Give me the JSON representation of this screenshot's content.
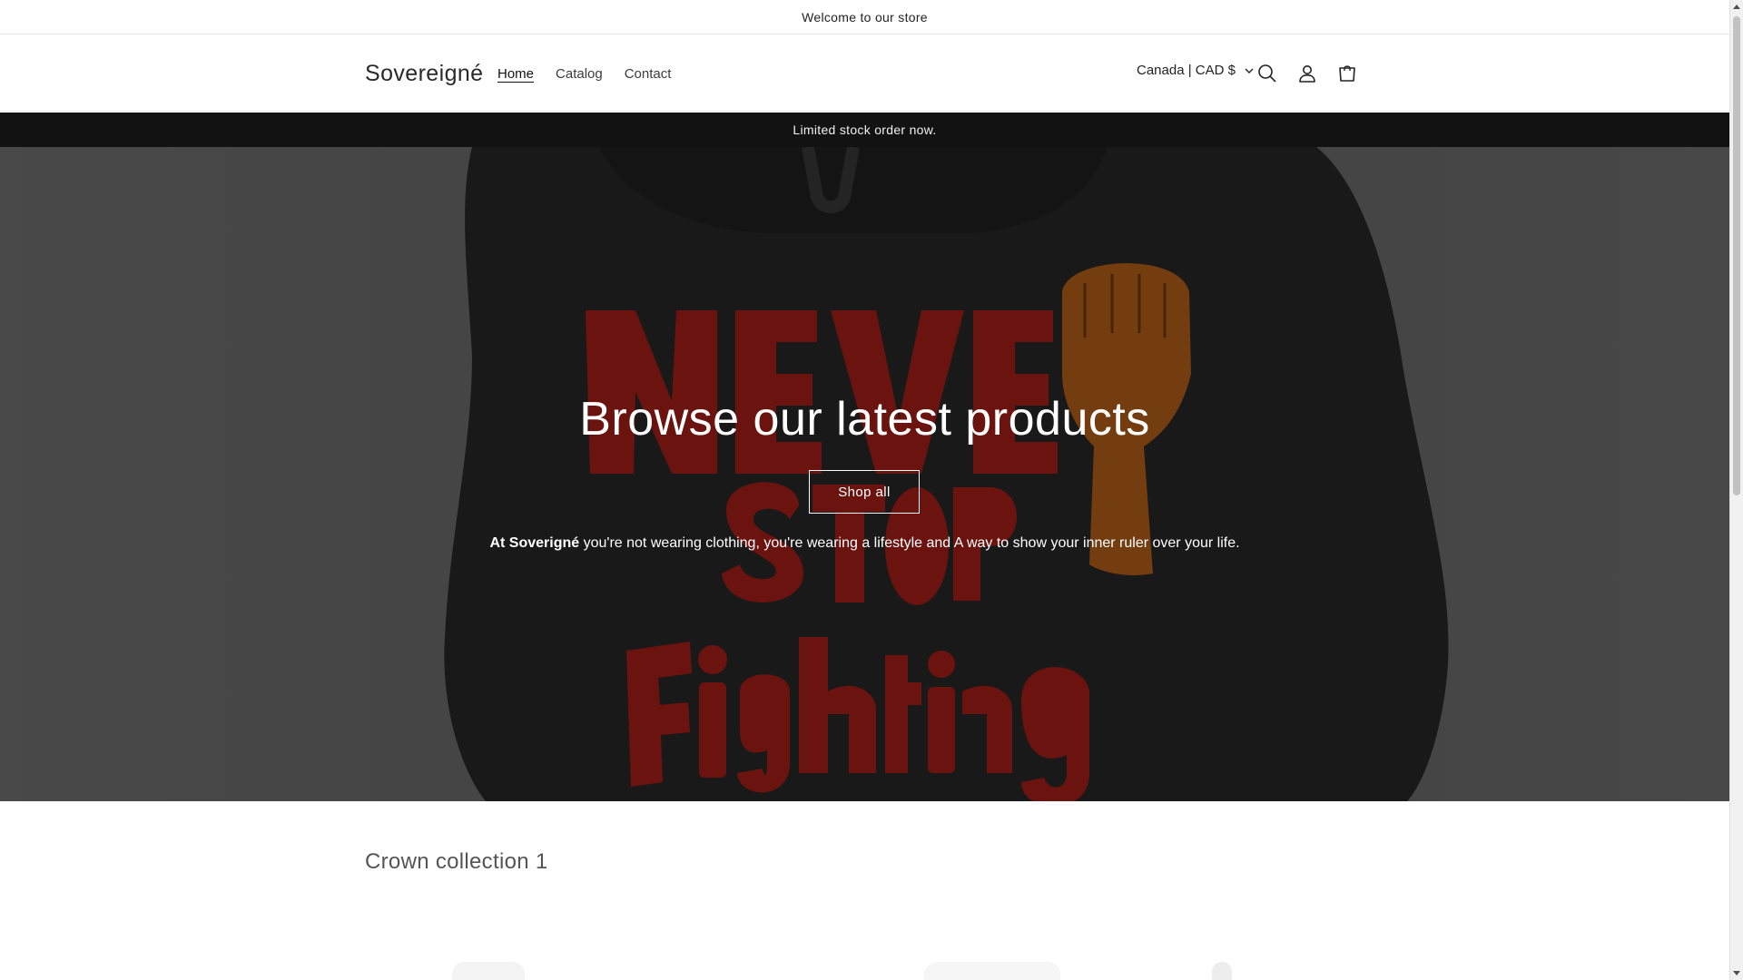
{
  "announcement": {
    "text": "Welcome to our store"
  },
  "header": {
    "logo": "Sovereigné",
    "nav": [
      {
        "label": "Home",
        "active": true
      },
      {
        "label": "Catalog",
        "active": false
      },
      {
        "label": "Contact",
        "active": false
      }
    ],
    "locale": "Canada | CAD $",
    "icons": [
      "search-icon",
      "account-icon",
      "cart-icon"
    ]
  },
  "promo": {
    "text": "Limited stock order now."
  },
  "hero": {
    "title": "Browse our latest products",
    "button": "Shop all",
    "text_bold": "At Soverigné",
    "text_rest": " you're not wearing clothing, you're wearing a lifestyle and A way to show your inner ruler over your life."
  },
  "collection": {
    "title": "Crown collection 1"
  },
  "colors": {
    "promo_bg": "#121212",
    "hero_overlay": "rgba(0,0,0,0.4)",
    "print_red": "#b3201a",
    "print_orange": "#c2661c"
  }
}
